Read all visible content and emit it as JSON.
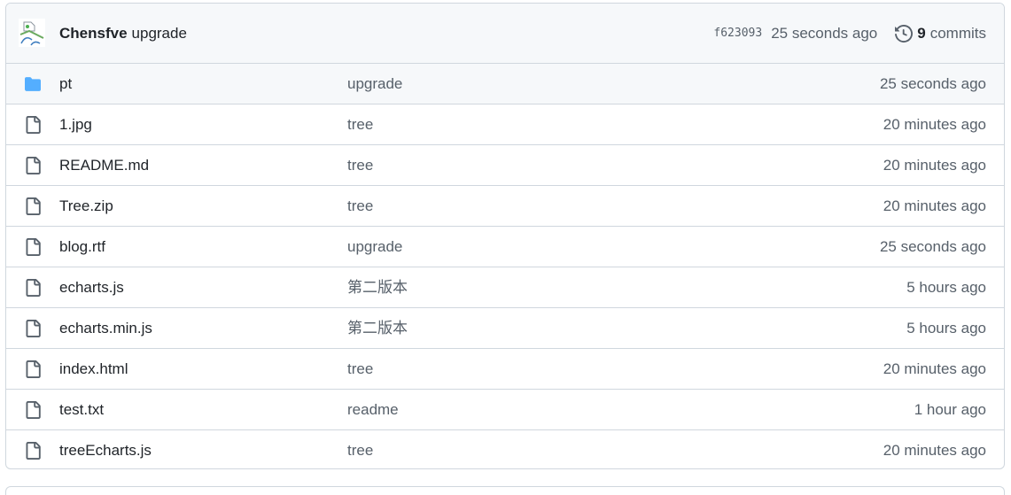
{
  "commit": {
    "author": "Chensfve",
    "message": "upgrade",
    "sha": "f623093",
    "time": "25 seconds ago",
    "commit_count": "9",
    "commits_label": "commits",
    "avatar_icon": "avatar-image",
    "history_icon": "history-icon"
  },
  "files": [
    {
      "type": "folder",
      "icon": "folder-icon",
      "name": "pt",
      "message": "upgrade",
      "age": "25 seconds ago"
    },
    {
      "type": "file",
      "icon": "file-icon",
      "name": "1.jpg",
      "message": "tree",
      "age": "20 minutes ago"
    },
    {
      "type": "file",
      "icon": "file-icon",
      "name": "README.md",
      "message": "tree",
      "age": "20 minutes ago"
    },
    {
      "type": "file",
      "icon": "file-icon",
      "name": "Tree.zip",
      "message": "tree",
      "age": "20 minutes ago"
    },
    {
      "type": "file",
      "icon": "file-icon",
      "name": "blog.rtf",
      "message": "upgrade",
      "age": "25 seconds ago"
    },
    {
      "type": "file",
      "icon": "file-icon",
      "name": "echarts.js",
      "message": "第二版本",
      "age": "5 hours ago"
    },
    {
      "type": "file",
      "icon": "file-icon",
      "name": "echarts.min.js",
      "message": "第二版本",
      "age": "5 hours ago"
    },
    {
      "type": "file",
      "icon": "file-icon",
      "name": "index.html",
      "message": "tree",
      "age": "20 minutes ago"
    },
    {
      "type": "file",
      "icon": "file-icon",
      "name": "test.txt",
      "message": "readme",
      "age": "1 hour ago"
    },
    {
      "type": "file",
      "icon": "file-icon",
      "name": "treeEcharts.js",
      "message": "tree",
      "age": "20 minutes ago"
    }
  ],
  "colors": {
    "folder": "#54aeff",
    "file_icon": "#57606a",
    "border": "#d0d7de",
    "header_bg": "#f6f8fa",
    "muted": "#57606a"
  }
}
